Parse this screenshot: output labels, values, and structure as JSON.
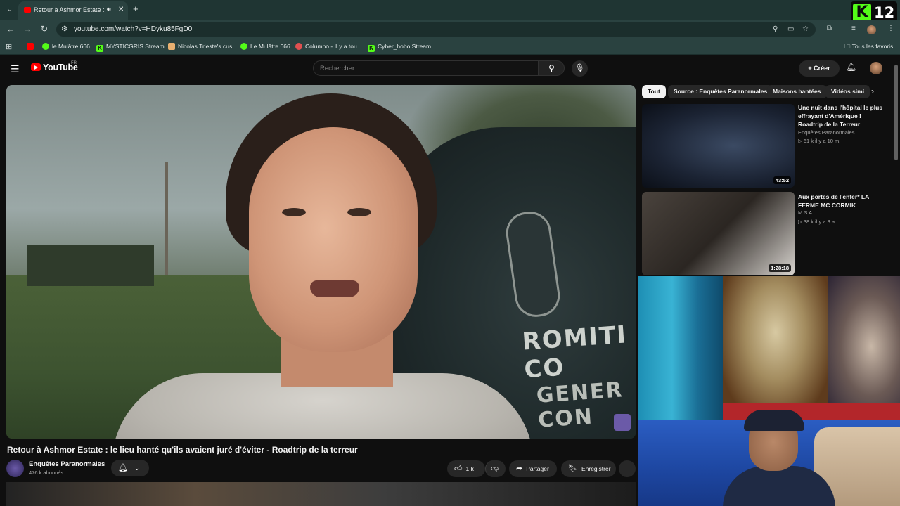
{
  "browser": {
    "tab_title": "Retour à Ashmor Estate : le",
    "url": "youtube.com/watch?v=HDyku85FgD0",
    "bookmarks": [
      {
        "label": "",
        "color": "#ff0000"
      },
      {
        "label": "le Mulâtre 666",
        "color": "#53fc18"
      },
      {
        "label": "MYSTICGRIS Stream...",
        "color": "#53fc18"
      },
      {
        "label": "Nicolas Trieste's cus...",
        "color": "#e8b070"
      },
      {
        "label": "Le Mulâtre 666",
        "color": "#53fc18"
      },
      {
        "label": "Columbo - Il y a tou...",
        "color": "#e05050"
      },
      {
        "label": "Cyber_hobo Stream...",
        "color": "#53fc18"
      }
    ],
    "all_bookmarks": "Tous les favoris",
    "overlay_badge": {
      "letter": "K",
      "number": "12",
      "accent": "#53fc18"
    }
  },
  "youtube": {
    "logo_text": "YouTube",
    "region": "FR",
    "search_placeholder": "Rechercher",
    "create_label": "Créer"
  },
  "video": {
    "title": "Retour à Ashmor Estate : le lieu hanté qu'ils avaient juré d'éviter - Roadtrip de la terreur",
    "truck_text_1": "ROMITI CO",
    "truck_text_2": "GENER CON",
    "channel_name": "Enquêtes Paranormales",
    "subscribers": "476 k abonnés",
    "likes": "1 k",
    "share_label": "Partager",
    "save_label": "Enregistrer"
  },
  "chips": [
    "Tout",
    "Source : Enquêtes Paranormales",
    "Maisons hantées",
    "Vidéos simi"
  ],
  "recommendations": [
    {
      "title": "Une nuit dans l'hôpital le plus effrayant d'Amérique ! Roadtrip de la Terreur",
      "channel": "Enquêtes Paranormales",
      "meta": "61 k  il y a 10 m.",
      "duration": "43:52"
    },
    {
      "title": "Aux portes de l'enfer* LA FERME MC CORMIK",
      "channel": "M S A",
      "meta": "38 k  il y a 3 a",
      "duration": "1:28:18"
    }
  ]
}
